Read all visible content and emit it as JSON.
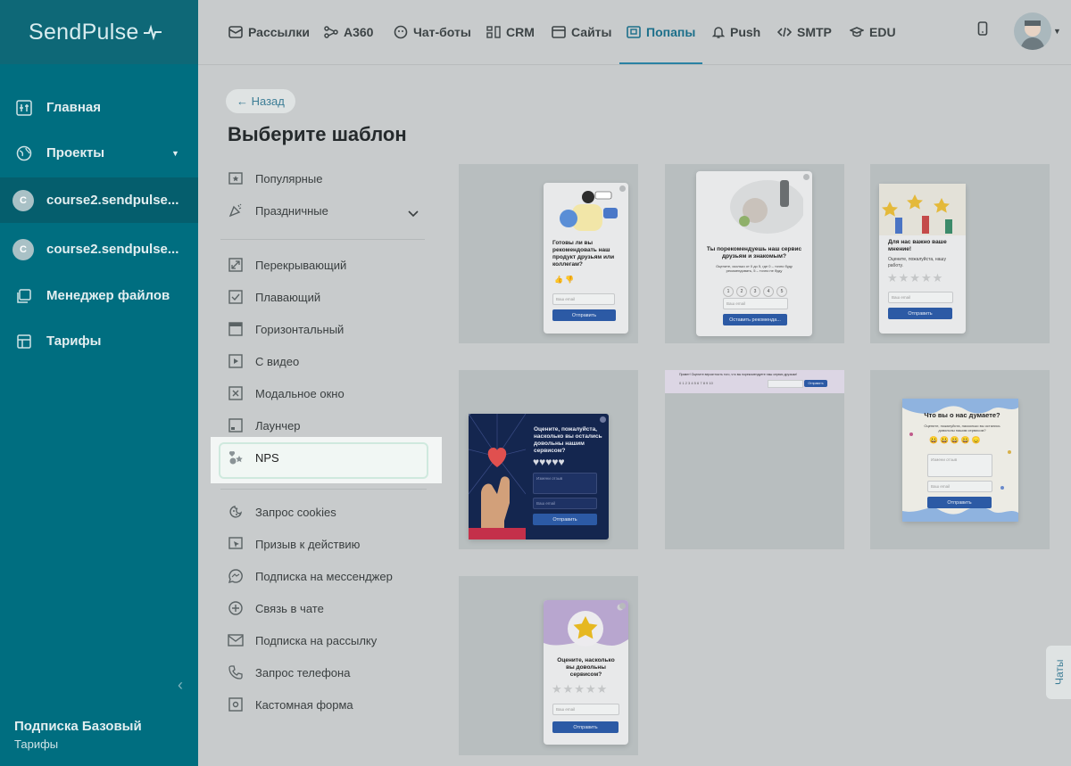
{
  "app": {
    "logo_text": "SendPulse"
  },
  "sidebar": {
    "items": [
      {
        "label": "Главная",
        "icon": "dashboard-icon"
      },
      {
        "label": "Проекты",
        "icon": "globe-icon"
      },
      {
        "label": "course2.sendpulse...",
        "avatar": "C"
      },
      {
        "label": "course2.sendpulse...",
        "avatar": "C"
      },
      {
        "label": "Менеджер файлов",
        "icon": "files-icon"
      },
      {
        "label": "Тарифы",
        "icon": "pricing-icon"
      }
    ],
    "plan_title": "Подписка Базовый",
    "plan_link": "Тарифы"
  },
  "topnav": {
    "items": [
      {
        "label": "Рассылки"
      },
      {
        "label": "A360"
      },
      {
        "label": "Чат-боты"
      },
      {
        "label": "CRM"
      },
      {
        "label": "Сайты"
      },
      {
        "label": "Попапы",
        "active": true
      },
      {
        "label": "Push"
      },
      {
        "label": "SMTP"
      },
      {
        "label": "EDU"
      }
    ]
  },
  "page": {
    "back_label": "← Назад",
    "title": "Выберите шаблон"
  },
  "categories": {
    "group1": [
      "Популярные",
      "Праздничные"
    ],
    "group2": [
      "Перекрывающий",
      "Плавающий",
      "Горизонтальный",
      "С видео",
      "Модальное окно",
      "Лаунчер",
      "NPS"
    ],
    "group3": [
      "Запрос cookies",
      "Призыв к действию",
      "Подписка на мессенджер",
      "Связь в чате",
      "Подписка на рассылку",
      "Запрос телефона",
      "Кастомная форма"
    ]
  },
  "templates": {
    "t1": {
      "title": "Готовы ли вы рекомендовать наш продукт друзьям или коллегам?",
      "input": "Ваш email",
      "button": "Отправить"
    },
    "t2": {
      "title": "Ты порекомендуешь наш сервис друзьям и знакомым?",
      "sub": "Оцените, сколько от 0 до 5, где 0 – точно буду рекомендовать, 5 – точно не буду",
      "scale": [
        "1",
        "2",
        "3",
        "4",
        "5"
      ],
      "input": "Ваш email",
      "button": "Оставить рекоменда..."
    },
    "t3": {
      "title": "Для нас важно ваше мнение!",
      "sub": "Оцените, пожалуйста, нашу работу.",
      "input": "Ваш email",
      "button": "Отправить"
    },
    "t4": {
      "title": "Оцените, пожалуйста, насколько вы остались довольны нашим сервисом?",
      "input1": "Измени отзыв",
      "input2": "Ваш email",
      "button": "Отправить"
    },
    "t5": {
      "text": "Привет! Оцените вероятность того, что вы порекомендуете наш сервис друзьям!",
      "button": "Отправить"
    },
    "t6": {
      "title": "Что вы о нас думаете?",
      "sub": "Оцените, пожалуйста, насколько вы остались довольны нашим сервисом?",
      "input1": "Измени отзыв",
      "input2": "Ваш email",
      "button": "Отправить"
    },
    "t7": {
      "title": "Оцените, насколько вы довольны сервисом?",
      "input": "Ваш email",
      "button": "Отправить"
    }
  },
  "chats_tab": "Чаты"
}
